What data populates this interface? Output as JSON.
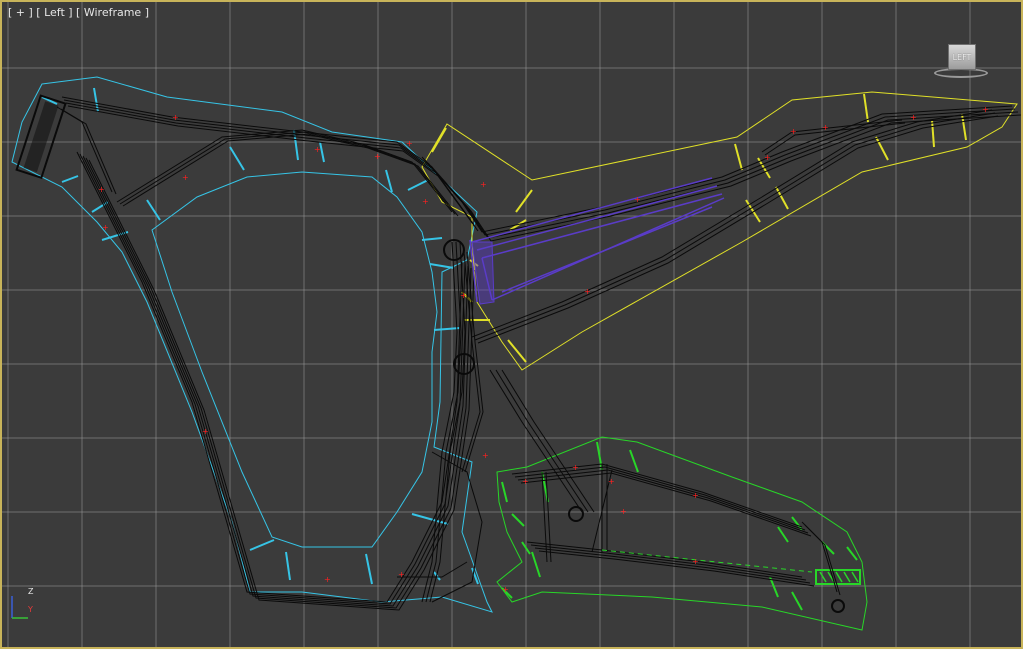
{
  "viewport": {
    "label": "[ + ] [ Left ] [ Wireframe ]",
    "active_border_color": "#c8b45a",
    "background_color": "#3b3b3b",
    "grid_color": "#9a9a9a"
  },
  "viewcube": {
    "face_label": "LEFT"
  },
  "axis_tripod": {
    "z_label": "Z",
    "y_label": "Y"
  },
  "selection_colors": {
    "front_triangle": "#36c4e6",
    "rear_triangle": "#e0e028",
    "swing_arm": "#28d628",
    "linkage": "#5a3cc8",
    "pivot_marker": "#ff2020"
  }
}
